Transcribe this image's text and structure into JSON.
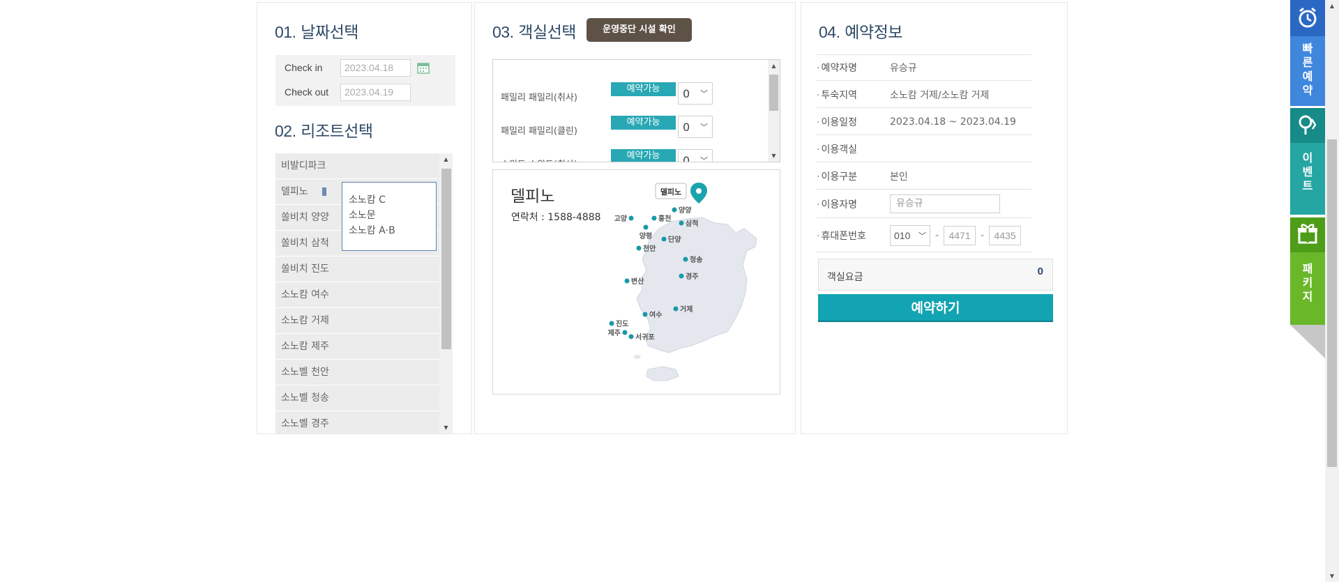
{
  "date_section": {
    "title_num": "01.",
    "title_text": "날짜선택",
    "checkin_label": "Check in",
    "checkin_value": "2023.04.18",
    "checkout_label": "Check out",
    "checkout_value": "2023.04.19"
  },
  "resort_section": {
    "title_num": "02.",
    "title_text": "리조트선택",
    "items": [
      "비발디파크",
      "델피노",
      "쏠비치 양양",
      "쏠비치 삼척",
      "쏠비치 진도",
      "소노캄 여수",
      "소노캄 거제",
      "소노캄 제주",
      "소노벨 천안",
      "소노벨 청송",
      "소노벨 경주"
    ],
    "popup_items": [
      "소노캄 C",
      "소노문",
      "소노캄 A·B"
    ]
  },
  "room_section": {
    "title_num": "03.",
    "title_text": "객실선택",
    "closure_button": "운영중단 시설 확인",
    "rooms": [
      {
        "name": "패밀리 패밀리(취사)",
        "status": "예약가능",
        "qty": "0"
      },
      {
        "name": "패밀리 패밀리(클린)",
        "status": "예약가능",
        "qty": "0"
      },
      {
        "name": "스위트 스위트(취사)",
        "status": "예약가능",
        "qty": "0"
      }
    ],
    "map": {
      "resort_name": "델피노",
      "contact": "연락처 : 1588-4888",
      "pin_label": "델피노",
      "cities": [
        "양양",
        "고양",
        "홍천",
        "삼척",
        "양평",
        "단양",
        "천안",
        "청송",
        "경주",
        "변산",
        "거제",
        "여수",
        "진도",
        "제주",
        "서귀포"
      ]
    }
  },
  "reservation_section": {
    "title_num": "04.",
    "title_text": "예약정보",
    "rows": [
      {
        "label": "예약자명",
        "value": "유승규"
      },
      {
        "label": "투숙지역",
        "value": "소노캄 거제/소노캄 거제"
      },
      {
        "label": "이용일정",
        "value": "2023.04.18 ~ 2023.04.19"
      },
      {
        "label": "이용객실",
        "value": ""
      },
      {
        "label": "이용구분",
        "value": "본인"
      }
    ],
    "user_label": "이용자명",
    "user_value": "유승규",
    "phone_label": "휴대폰번호",
    "phone_prefix": "010",
    "phone_mid": "4471",
    "phone_last": "4435",
    "fee_label": "객실요금",
    "fee_value": "0",
    "reserve_button": "예약하기"
  },
  "quick_menu": {
    "fast": "빠른예약",
    "event": "이벤트",
    "package": "패키지"
  },
  "colors": {
    "accent": "#12a4b3",
    "title": "#2f4a68",
    "fast": "#3f86dd",
    "event": "#26a6a2",
    "package": "#6ab72a"
  }
}
